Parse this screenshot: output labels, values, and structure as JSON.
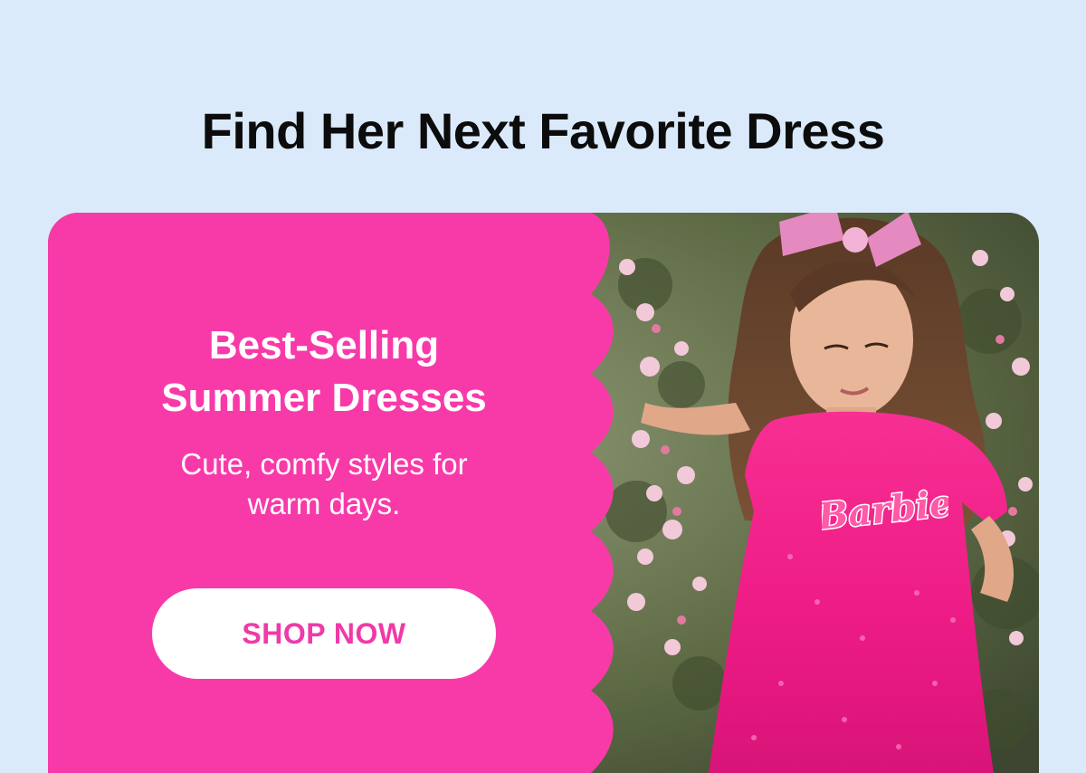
{
  "header": {
    "title": "Find Her Next Favorite Dress"
  },
  "promo": {
    "title_lines": [
      "Best-Selling",
      "Summer Dresses"
    ],
    "subtitle_lines": [
      "Cute, comfy styles for",
      "warm days."
    ],
    "cta_label": "SHOP NOW"
  },
  "photo": {
    "logo_text": "Barbie"
  },
  "colors": {
    "page_bg": "#dbeafb",
    "promo_pink": "#f83aa9",
    "cta_text": "#f03aa8",
    "dress_pink": "#f0208a"
  }
}
